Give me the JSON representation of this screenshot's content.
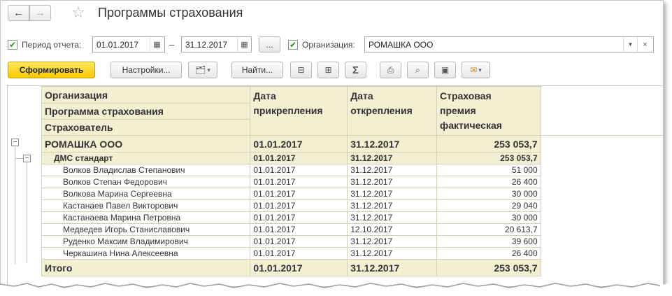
{
  "window": {
    "title": "Программы страхования"
  },
  "filters": {
    "period_label": "Период отчета:",
    "date_from": "01.01.2017",
    "date_to": "31.12.2017",
    "dash": "–",
    "ellipsis": "...",
    "org_label": "Организация:",
    "org_value": "РОМАШКА ООО"
  },
  "toolbar": {
    "generate": "Сформировать",
    "settings": "Настройки...",
    "find": "Найти..."
  },
  "report": {
    "headers": {
      "col1_line1": "Организация",
      "col1_line2": "Программа страхования",
      "col1_line3": "Страхователь",
      "col2_line1": "Дата",
      "col2_line2": "прикрепления",
      "col3_line1": "Дата",
      "col3_line2": "открепления",
      "col4_line1": "Страховая",
      "col4_line2": "премия",
      "col4_line3": "фактическая"
    },
    "group": {
      "name": "РОМАШКА ООО",
      "attach": "01.01.2017",
      "detach": "31.12.2017",
      "premium": "253 053,7"
    },
    "subgroup": {
      "name": "ДМС стандарт",
      "attach": "01.01.2017",
      "detach": "31.12.2017",
      "premium": "253 053,7"
    },
    "rows": [
      {
        "name": "Волков Владислав Степанович",
        "attach": "01.01.2017",
        "detach": "31.12.2017",
        "premium": "51 000"
      },
      {
        "name": "Волков Степан Федорович",
        "attach": "01.01.2017",
        "detach": "31.12.2017",
        "premium": "26 400"
      },
      {
        "name": "Волкова Марина Сергеевна",
        "attach": "01.01.2017",
        "detach": "31.12.2017",
        "premium": "30 000"
      },
      {
        "name": "Кастанаев Павел Викторович",
        "attach": "01.01.2017",
        "detach": "31.12.2017",
        "premium": "29 040"
      },
      {
        "name": "Кастанаева Марина Петровна",
        "attach": "01.01.2017",
        "detach": "31.12.2017",
        "premium": "30 000"
      },
      {
        "name": "Медведев Игорь Станиславович",
        "attach": "01.01.2017",
        "detach": "12.10.2017",
        "premium": "20 613,7"
      },
      {
        "name": "Руденко Максим Владимирович",
        "attach": "01.01.2017",
        "detach": "31.12.2017",
        "premium": "39 600"
      },
      {
        "name": "Черкашина Нина Алексеевна",
        "attach": "01.01.2017",
        "detach": "31.12.2017",
        "premium": "26 400"
      }
    ],
    "total": {
      "name": "Итого",
      "attach": "01.01.2017",
      "detach": "31.12.2017",
      "premium": "253 053,7"
    }
  }
}
